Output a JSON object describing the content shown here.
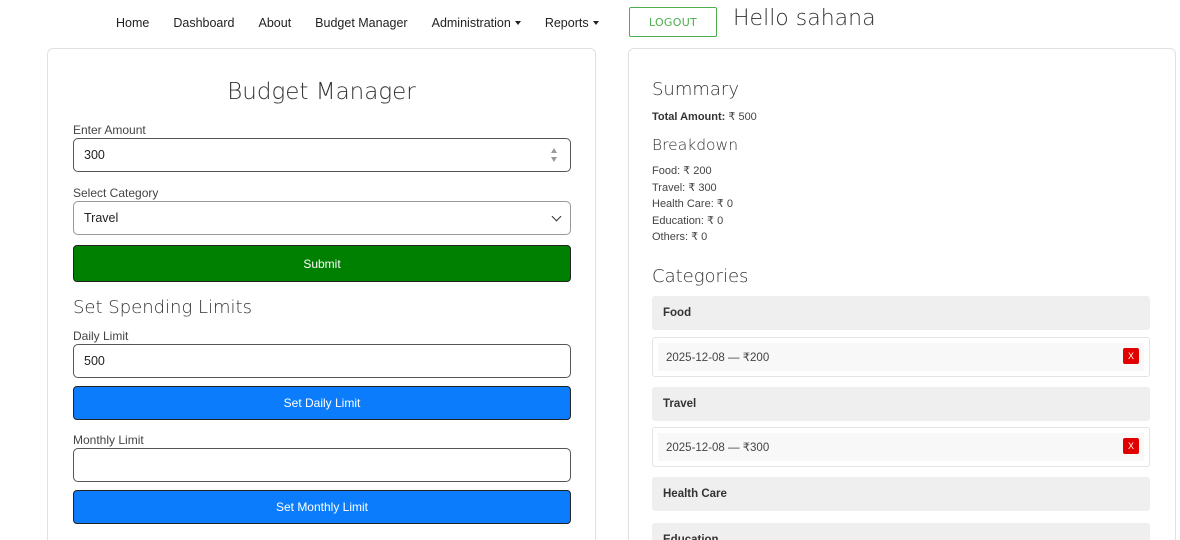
{
  "nav": {
    "home": "Home",
    "dashboard": "Dashboard",
    "about": "About",
    "budget_manager": "Budget Manager",
    "administration": "Administration",
    "reports": "Reports",
    "logout": "LOGOUT",
    "greeting": "Hello sahana"
  },
  "form": {
    "title": "Budget Manager",
    "amount_label": "Enter Amount",
    "amount_value": "300",
    "category_label": "Select Category",
    "category_value": "Travel",
    "submit": "Submit",
    "limits_title": "Set Spending Limits",
    "daily_label": "Daily Limit",
    "daily_value": "500",
    "daily_button": "Set Daily Limit",
    "monthly_label": "Monthly Limit",
    "monthly_value": "",
    "monthly_button": "Set Monthly Limit"
  },
  "summary": {
    "title": "Summary",
    "total_label": "Total Amount:",
    "total_value": "₹ 500",
    "breakdown_title": "Breakdown",
    "breakdown": [
      "Food: ₹ 200",
      "Travel: ₹ 300",
      "Health Care: ₹ 0",
      "Education: ₹ 0",
      "Others: ₹ 0"
    ]
  },
  "categories": {
    "title": "Categories",
    "food": {
      "name": "Food",
      "entry": "2025-12-08 — ₹200",
      "delete": "X"
    },
    "travel": {
      "name": "Travel",
      "entry": "2025-12-08 — ₹300",
      "delete": "X"
    },
    "health": {
      "name": "Health Care"
    },
    "education": {
      "name": "Education"
    }
  }
}
